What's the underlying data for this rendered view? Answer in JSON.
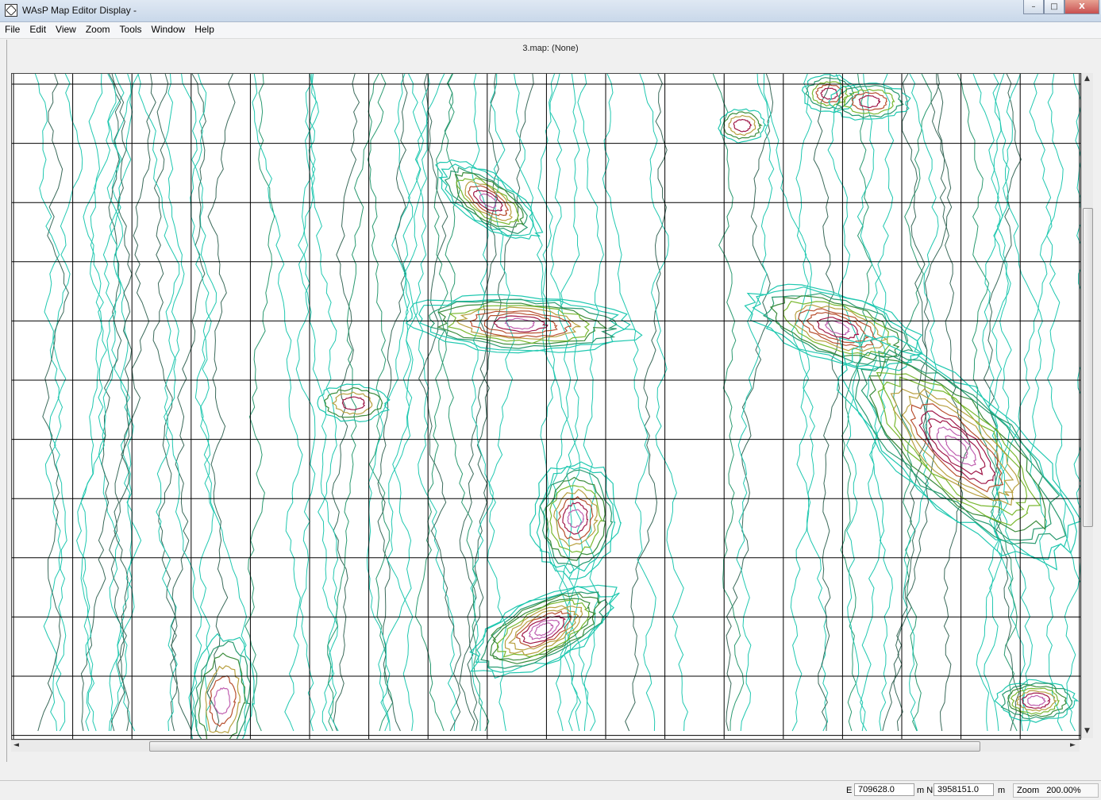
{
  "window": {
    "title": "WAsP Map Editor Display -",
    "buttons": {
      "minimize": "–",
      "maximize": "□",
      "close": "X"
    }
  },
  "menu": [
    "File",
    "Edit",
    "View",
    "Zoom",
    "Tools",
    "Window",
    "Help"
  ],
  "document": {
    "title": "3.map: (None)"
  },
  "map": {
    "grid_color": "#000000",
    "contour_colors": [
      "#20c8b0",
      "#2a9a70",
      "#3c8c3c",
      "#7ab830",
      "#b8a040",
      "#b85030",
      "#a01848",
      "#c060b0"
    ]
  },
  "status": {
    "e_label": "E",
    "e_value": "709628.0",
    "n_label": "m N",
    "n_value": "3958151.0",
    "unit": "m",
    "zoom_label": "Zoom",
    "zoom_value": "200.00%"
  }
}
